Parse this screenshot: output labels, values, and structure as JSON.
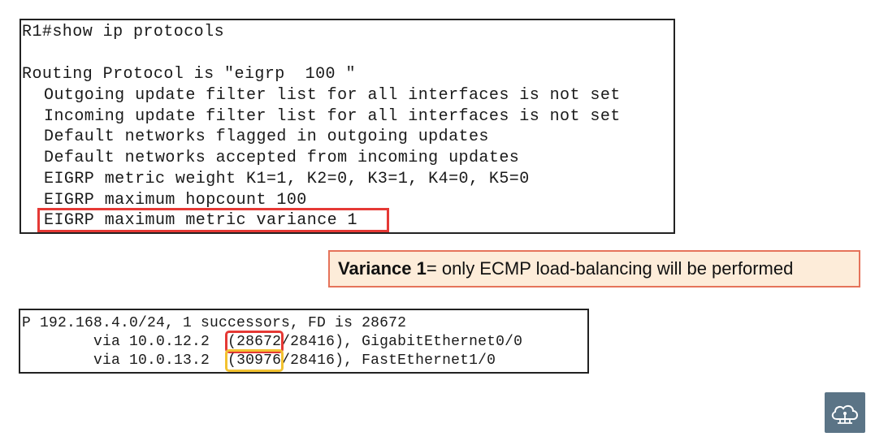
{
  "terminal_top": {
    "lines": [
      "R1#show ip protocols",
      "",
      "Routing Protocol is \"eigrp  100 \"",
      "Outgoing update filter list for all interfaces is not set",
      "Incoming update filter list for all interfaces is not set",
      "Default networks flagged in outgoing updates",
      "Default networks accepted from incoming updates",
      "EIGRP metric weight K1=1, K2=0, K3=1, K4=0, K5=0",
      "EIGRP maximum hopcount 100",
      "EIGRP maximum metric variance 1"
    ]
  },
  "callout": {
    "bold": "Variance 1",
    "rest": " = only ECMP load-balancing will be performed"
  },
  "terminal_bottom": {
    "line1": "P 192.168.4.0/24, 1 successors, FD is 28672",
    "route1": {
      "prefix": "        via 10.0.12.2  ",
      "paren_open": "(",
      "metric": "28672",
      "rest": "/28416), GigabitEthernet0/0"
    },
    "route2": {
      "prefix": "        via 10.0.13.2  ",
      "paren_open": "(",
      "metric": "30976",
      "rest": "/28416), FastEthernet1/0"
    }
  },
  "colors": {
    "highlight_red": "#e53935",
    "highlight_yellow": "#f2c230",
    "callout_bg": "#fdecd9",
    "callout_border": "#e5735a",
    "logo_bg": "#5b7486"
  },
  "icons": {
    "logo": "cloud-network-icon"
  }
}
